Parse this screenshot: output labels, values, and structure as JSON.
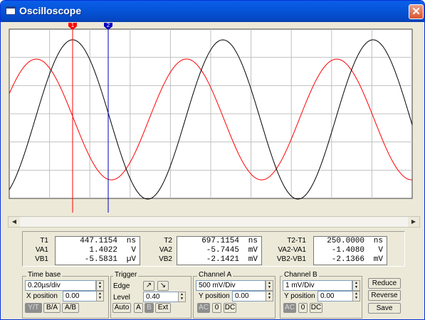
{
  "window": {
    "title": "Oscilloscope",
    "close_glyph": "✕",
    "icon": "window-icon"
  },
  "cursors": {
    "t1_label": "1",
    "t2_label": "2",
    "t1_color": "#ff0000",
    "t2_color": "#0000c0"
  },
  "traces": {
    "channel_a_color": "#ff0000",
    "channel_b_color": "#000000",
    "grid_color": "#c0c0c0"
  },
  "readout": {
    "col1": {
      "labels": [
        "T1",
        "VA1",
        "VB1"
      ],
      "values": [
        {
          "num": "447.1154",
          "unit": "ns"
        },
        {
          "num": "1.4022",
          "unit": "V"
        },
        {
          "num": "-5.5831",
          "unit": "µV"
        }
      ]
    },
    "col2": {
      "labels": [
        "T2",
        "VA2",
        "VB2"
      ],
      "values": [
        {
          "num": "697.1154",
          "unit": "ns"
        },
        {
          "num": "-5.7445",
          "unit": "mV"
        },
        {
          "num": "-2.1421",
          "unit": "mV"
        }
      ]
    },
    "col3": {
      "labels": [
        "T2-T1",
        "VA2-VA1",
        "VB2-VB1"
      ],
      "values": [
        {
          "num": "250.0000",
          "unit": "ns"
        },
        {
          "num": "-1.4080",
          "unit": "V"
        },
        {
          "num": "-2.1366",
          "unit": "mV"
        }
      ]
    }
  },
  "timebase": {
    "title": "Time base",
    "scale": "0.20µs/div",
    "xpos_label": "X position",
    "xpos_value": "0.00",
    "modes": [
      "Y/T",
      "B/A",
      "A/B"
    ]
  },
  "trigger": {
    "title": "Trigger",
    "edge_label": "Edge",
    "level_label": "Level",
    "level_value": "0.40",
    "buttons": [
      "Auto",
      "A",
      "B",
      "Ext"
    ]
  },
  "channel_a": {
    "title": "Channel A",
    "scale": "500 mV/Div",
    "ypos_label": "Y position",
    "ypos_value": "0.00",
    "coupling": [
      "AC",
      "0",
      "DC"
    ]
  },
  "channel_b": {
    "title": "Channel B",
    "scale": "1 mV/Div",
    "ypos_label": "Y position",
    "ypos_value": "0.00",
    "coupling": [
      "AC",
      "0",
      "DC"
    ]
  },
  "actions": {
    "reduce": "Reduce",
    "reverse": "Reverse",
    "save": "Save"
  }
}
